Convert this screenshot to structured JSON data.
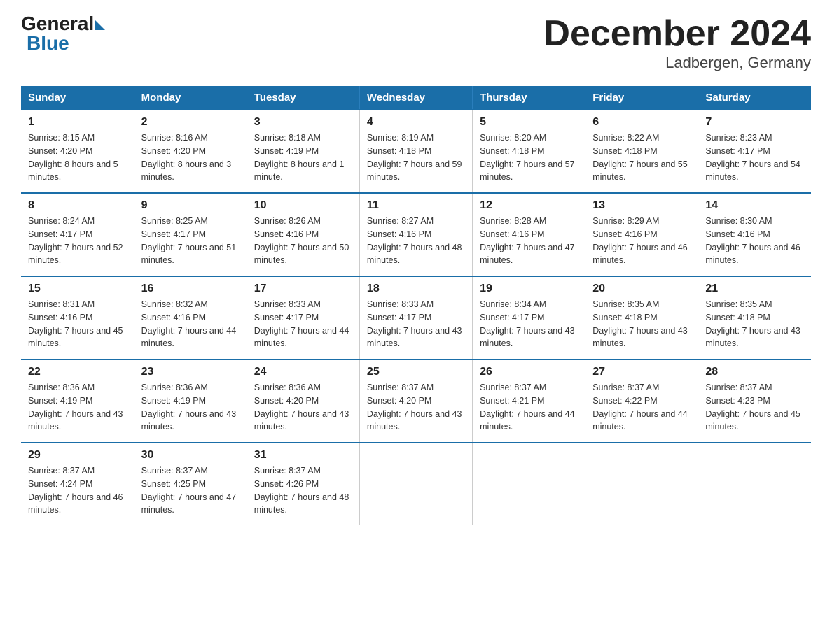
{
  "header": {
    "logo_general": "General",
    "logo_blue": "Blue",
    "month_title": "December 2024",
    "location": "Ladbergen, Germany"
  },
  "weekdays": [
    "Sunday",
    "Monday",
    "Tuesday",
    "Wednesday",
    "Thursday",
    "Friday",
    "Saturday"
  ],
  "weeks": [
    [
      {
        "num": "1",
        "sunrise": "8:15 AM",
        "sunset": "4:20 PM",
        "daylight": "8 hours and 5 minutes."
      },
      {
        "num": "2",
        "sunrise": "8:16 AM",
        "sunset": "4:20 PM",
        "daylight": "8 hours and 3 minutes."
      },
      {
        "num": "3",
        "sunrise": "8:18 AM",
        "sunset": "4:19 PM",
        "daylight": "8 hours and 1 minute."
      },
      {
        "num": "4",
        "sunrise": "8:19 AM",
        "sunset": "4:18 PM",
        "daylight": "7 hours and 59 minutes."
      },
      {
        "num": "5",
        "sunrise": "8:20 AM",
        "sunset": "4:18 PM",
        "daylight": "7 hours and 57 minutes."
      },
      {
        "num": "6",
        "sunrise": "8:22 AM",
        "sunset": "4:18 PM",
        "daylight": "7 hours and 55 minutes."
      },
      {
        "num": "7",
        "sunrise": "8:23 AM",
        "sunset": "4:17 PM",
        "daylight": "7 hours and 54 minutes."
      }
    ],
    [
      {
        "num": "8",
        "sunrise": "8:24 AM",
        "sunset": "4:17 PM",
        "daylight": "7 hours and 52 minutes."
      },
      {
        "num": "9",
        "sunrise": "8:25 AM",
        "sunset": "4:17 PM",
        "daylight": "7 hours and 51 minutes."
      },
      {
        "num": "10",
        "sunrise": "8:26 AM",
        "sunset": "4:16 PM",
        "daylight": "7 hours and 50 minutes."
      },
      {
        "num": "11",
        "sunrise": "8:27 AM",
        "sunset": "4:16 PM",
        "daylight": "7 hours and 48 minutes."
      },
      {
        "num": "12",
        "sunrise": "8:28 AM",
        "sunset": "4:16 PM",
        "daylight": "7 hours and 47 minutes."
      },
      {
        "num": "13",
        "sunrise": "8:29 AM",
        "sunset": "4:16 PM",
        "daylight": "7 hours and 46 minutes."
      },
      {
        "num": "14",
        "sunrise": "8:30 AM",
        "sunset": "4:16 PM",
        "daylight": "7 hours and 46 minutes."
      }
    ],
    [
      {
        "num": "15",
        "sunrise": "8:31 AM",
        "sunset": "4:16 PM",
        "daylight": "7 hours and 45 minutes."
      },
      {
        "num": "16",
        "sunrise": "8:32 AM",
        "sunset": "4:16 PM",
        "daylight": "7 hours and 44 minutes."
      },
      {
        "num": "17",
        "sunrise": "8:33 AM",
        "sunset": "4:17 PM",
        "daylight": "7 hours and 44 minutes."
      },
      {
        "num": "18",
        "sunrise": "8:33 AM",
        "sunset": "4:17 PM",
        "daylight": "7 hours and 43 minutes."
      },
      {
        "num": "19",
        "sunrise": "8:34 AM",
        "sunset": "4:17 PM",
        "daylight": "7 hours and 43 minutes."
      },
      {
        "num": "20",
        "sunrise": "8:35 AM",
        "sunset": "4:18 PM",
        "daylight": "7 hours and 43 minutes."
      },
      {
        "num": "21",
        "sunrise": "8:35 AM",
        "sunset": "4:18 PM",
        "daylight": "7 hours and 43 minutes."
      }
    ],
    [
      {
        "num": "22",
        "sunrise": "8:36 AM",
        "sunset": "4:19 PM",
        "daylight": "7 hours and 43 minutes."
      },
      {
        "num": "23",
        "sunrise": "8:36 AM",
        "sunset": "4:19 PM",
        "daylight": "7 hours and 43 minutes."
      },
      {
        "num": "24",
        "sunrise": "8:36 AM",
        "sunset": "4:20 PM",
        "daylight": "7 hours and 43 minutes."
      },
      {
        "num": "25",
        "sunrise": "8:37 AM",
        "sunset": "4:20 PM",
        "daylight": "7 hours and 43 minutes."
      },
      {
        "num": "26",
        "sunrise": "8:37 AM",
        "sunset": "4:21 PM",
        "daylight": "7 hours and 44 minutes."
      },
      {
        "num": "27",
        "sunrise": "8:37 AM",
        "sunset": "4:22 PM",
        "daylight": "7 hours and 44 minutes."
      },
      {
        "num": "28",
        "sunrise": "8:37 AM",
        "sunset": "4:23 PM",
        "daylight": "7 hours and 45 minutes."
      }
    ],
    [
      {
        "num": "29",
        "sunrise": "8:37 AM",
        "sunset": "4:24 PM",
        "daylight": "7 hours and 46 minutes."
      },
      {
        "num": "30",
        "sunrise": "8:37 AM",
        "sunset": "4:25 PM",
        "daylight": "7 hours and 47 minutes."
      },
      {
        "num": "31",
        "sunrise": "8:37 AM",
        "sunset": "4:26 PM",
        "daylight": "7 hours and 48 minutes."
      },
      null,
      null,
      null,
      null
    ]
  ]
}
